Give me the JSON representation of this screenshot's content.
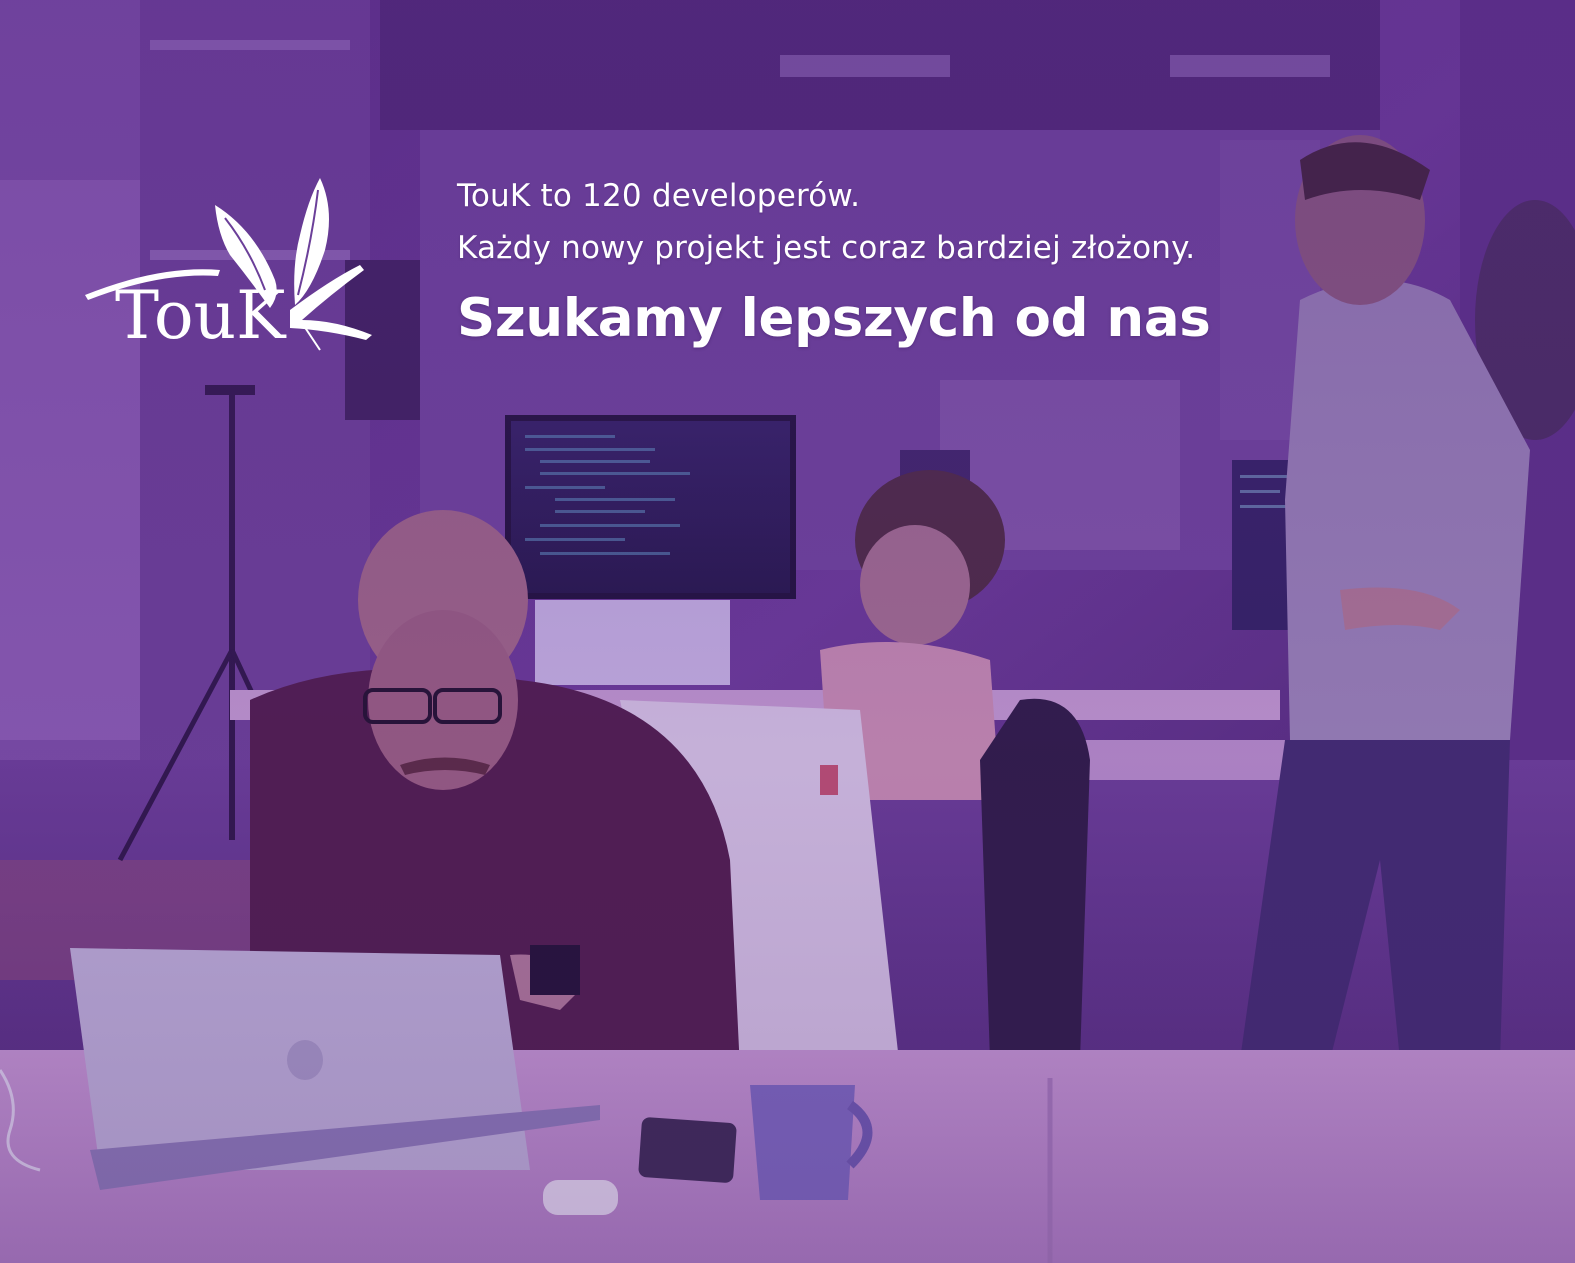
{
  "brand": {
    "logo_text": "TouK",
    "color_overlay": "#6b2fa0",
    "text_color": "#ffffff"
  },
  "copy": {
    "line1": "TouK to 120 developerów.",
    "line2": "Każdy nowy projekt jest coraz bardziej złożony.",
    "headline": "Szukamy lepszych od nas"
  },
  "scene": {
    "description_icon": "office-photo"
  }
}
